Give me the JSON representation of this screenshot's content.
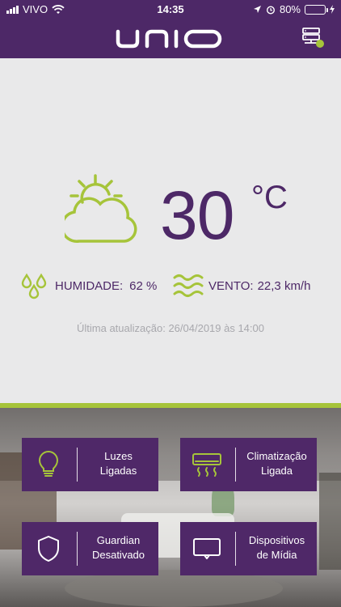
{
  "status_bar": {
    "carrier": "VIVO",
    "time": "14:35",
    "battery": "80%",
    "battery_level": 0.8
  },
  "header": {
    "logo": "UNIO"
  },
  "weather": {
    "temperature": "30",
    "unit": "°C",
    "humidity_label": "HUMIDADE:",
    "humidity_value": "62 %",
    "wind_label": "VENTO:",
    "wind_value": "22,3 km/h",
    "updated": "Última atualização: 26/04/2019 às 14:00"
  },
  "colors": {
    "accent": "#a6c43a",
    "brand": "#4d2867",
    "tile": "#4f2868"
  },
  "tiles": [
    {
      "label": "Luzes\nLigadas",
      "icon": "lightbulb-icon"
    },
    {
      "label": "Climatização\nLigada",
      "icon": "air-conditioner-icon"
    },
    {
      "label": "Guardian\nDesativado",
      "icon": "shield-icon"
    },
    {
      "label": "Dispositivos\nde Mídia",
      "icon": "tv-icon"
    }
  ]
}
